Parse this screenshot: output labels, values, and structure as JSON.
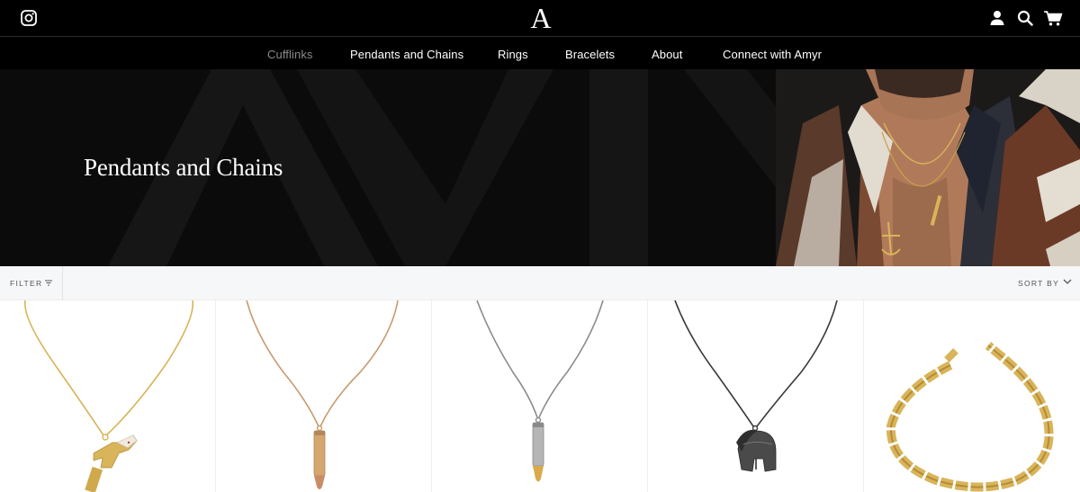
{
  "header": {
    "instagram_icon": "instagram-icon",
    "logo_text": "A",
    "account_icon": "user-icon",
    "search_icon": "search-icon",
    "cart_icon": "cart-icon"
  },
  "nav": {
    "items": [
      {
        "label": "Cufflinks",
        "active": true
      },
      {
        "label": "Pendants and Chains",
        "active": false
      },
      {
        "label": "Rings",
        "active": false
      },
      {
        "label": "Bracelets",
        "active": false
      },
      {
        "label": "About",
        "active": false
      },
      {
        "label": "Connect with Amyr",
        "active": false
      }
    ]
  },
  "hero": {
    "title": "Pendants and Chains"
  },
  "toolbar": {
    "filter_label": "FILTER",
    "sort_label": "SORT BY"
  },
  "products": [
    {
      "name": "revolver-pendant",
      "metal": "gold"
    },
    {
      "name": "bullet-pendant",
      "metal": "rose-gold"
    },
    {
      "name": "bullet-pendant",
      "metal": "silver"
    },
    {
      "name": "spartan-helmet-pendant",
      "metal": "black"
    },
    {
      "name": "chain-bracelet",
      "metal": "gold"
    }
  ],
  "colors": {
    "header_bg": "#000000",
    "hero_bg": "#0b0b0b",
    "active_nav": "#8a8a8a",
    "gold": "#d8b45a",
    "rose_gold": "#c99a6e",
    "silver": "#9a9a9a",
    "black_metal": "#3a3a3a"
  }
}
